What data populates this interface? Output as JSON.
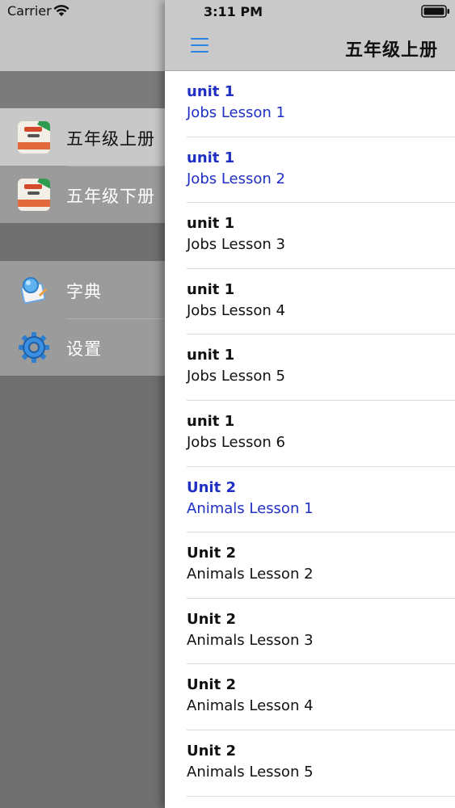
{
  "status_bar": {
    "carrier": "Carrier",
    "time": "3:11 PM"
  },
  "side_menu": {
    "books": [
      {
        "label": "五年级上册",
        "selected": true
      },
      {
        "label": "五年级下册",
        "selected": false
      }
    ],
    "tools": [
      {
        "label": "字典",
        "icon": "dictionary-icon"
      },
      {
        "label": "设置",
        "icon": "gear-icon"
      }
    ]
  },
  "nav": {
    "title": "五年级上册",
    "menu_icon": "hamburger-menu-icon"
  },
  "colors": {
    "accent": "#2a84e0",
    "active_text": "#1f2fc4"
  },
  "lessons": [
    {
      "unit": "unit 1",
      "lesson": "Jobs Lesson 1",
      "active": true
    },
    {
      "unit": "unit 1",
      "lesson": "Jobs Lesson 2",
      "active": true
    },
    {
      "unit": "unit 1",
      "lesson": "Jobs Lesson 3",
      "active": false
    },
    {
      "unit": "unit 1",
      "lesson": "Jobs Lesson 4",
      "active": false
    },
    {
      "unit": "unit 1",
      "lesson": "Jobs Lesson 5",
      "active": false
    },
    {
      "unit": "unit 1",
      "lesson": "Jobs Lesson 6",
      "active": false
    },
    {
      "unit": "Unit 2",
      "lesson": "Animals Lesson 1",
      "active": true
    },
    {
      "unit": "Unit 2",
      "lesson": "Animals Lesson 2",
      "active": false
    },
    {
      "unit": "Unit 2",
      "lesson": "Animals Lesson 3",
      "active": false
    },
    {
      "unit": "Unit 2",
      "lesson": "Animals Lesson 4",
      "active": false
    },
    {
      "unit": "Unit 2",
      "lesson": "Animals Lesson 5",
      "active": false
    }
  ]
}
